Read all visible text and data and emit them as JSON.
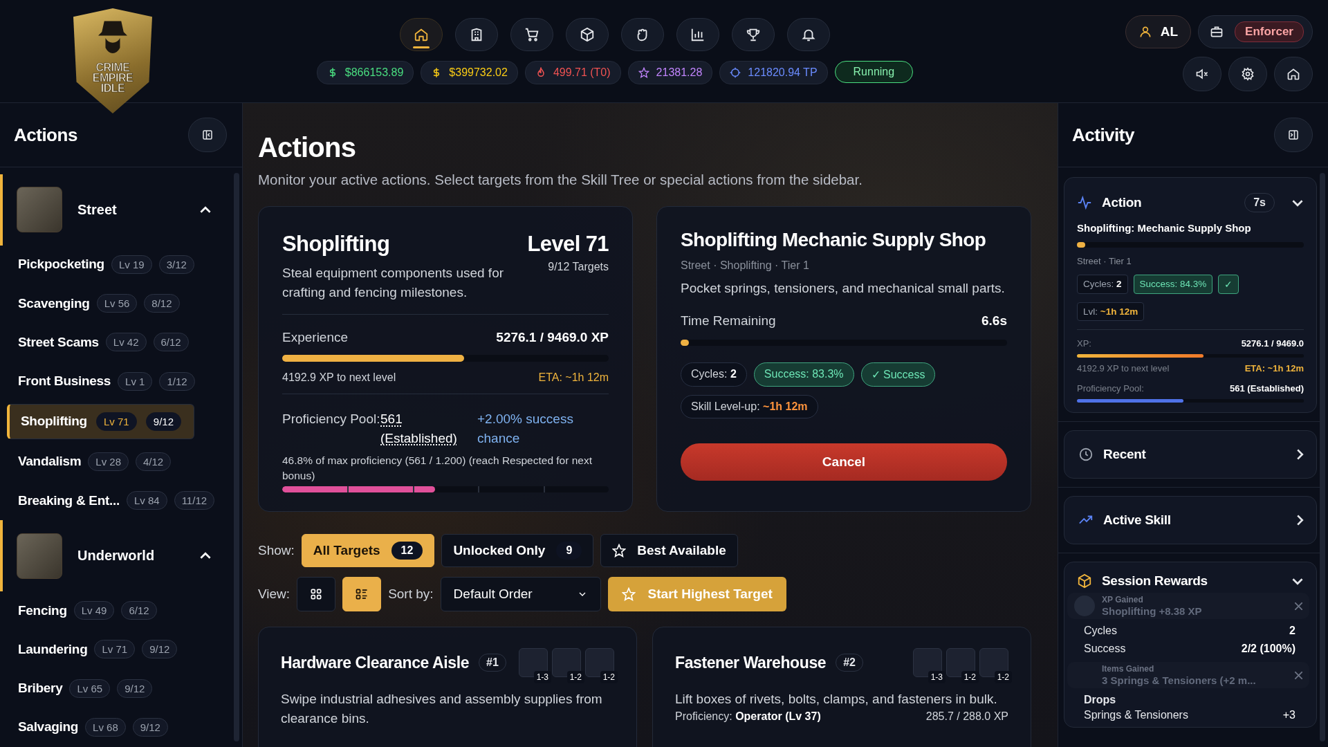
{
  "header": {
    "logo_lines": [
      "CRIME",
      "EMPIRE",
      "IDLE"
    ],
    "nav": [
      {
        "kind": "home",
        "selected": true
      },
      {
        "kind": "building",
        "selected": false
      },
      {
        "kind": "cart",
        "selected": false
      },
      {
        "kind": "box",
        "selected": false
      },
      {
        "kind": "fist",
        "selected": false
      },
      {
        "kind": "chart",
        "selected": false
      },
      {
        "kind": "trophy",
        "selected": false
      },
      {
        "kind": "bell",
        "selected": false
      }
    ],
    "resources": [
      {
        "kind": "dollar",
        "text": "$866153.89",
        "color": "#4ade80"
      },
      {
        "kind": "dollar",
        "text": "$399732.02",
        "color": "#facc15"
      },
      {
        "kind": "flame",
        "text": "499.71 (T0)",
        "color": "#f05252"
      },
      {
        "kind": "star",
        "text": "21381.28",
        "color": "#c084fc"
      },
      {
        "kind": "target",
        "text": "121820.94 TP",
        "color": "#6b8cff"
      }
    ],
    "status": "Running",
    "user": "AL",
    "rank": "Enforcer"
  },
  "sidebar": {
    "title": "Actions",
    "groups": [
      {
        "name": "Street",
        "expanded": true,
        "items": [
          {
            "name": "Pickpocketing",
            "level": "Lv 19",
            "targets": "3/12",
            "selected": false
          },
          {
            "name": "Scavenging",
            "level": "Lv 56",
            "targets": "8/12",
            "selected": false
          },
          {
            "name": "Street Scams",
            "level": "Lv 42",
            "targets": "6/12",
            "selected": false
          },
          {
            "name": "Front Business",
            "level": "Lv 1",
            "targets": "1/12",
            "selected": false
          },
          {
            "name": "Shoplifting",
            "level": "Lv 71",
            "targets": "9/12",
            "selected": true
          },
          {
            "name": "Vandalism",
            "level": "Lv 28",
            "targets": "4/12",
            "selected": false
          },
          {
            "name": "Breaking & Ent...",
            "level": "Lv 84",
            "targets": "11/12",
            "selected": false
          }
        ]
      },
      {
        "name": "Underworld",
        "expanded": true,
        "items": [
          {
            "name": "Fencing",
            "level": "Lv 49",
            "targets": "6/12",
            "selected": false
          },
          {
            "name": "Laundering",
            "level": "Lv 71",
            "targets": "9/12",
            "selected": false
          },
          {
            "name": "Bribery",
            "level": "Lv 65",
            "targets": "9/12",
            "selected": false
          },
          {
            "name": "Salvaging",
            "level": "Lv 68",
            "targets": "9/12",
            "selected": false
          }
        ]
      }
    ]
  },
  "main": {
    "title": "Actions",
    "subtitle": "Monitor your active actions. Select targets from the Skill Tree or special actions from the sidebar.",
    "skill_card": {
      "name": "Shoplifting",
      "level": "Level 71",
      "targets": "9/12 Targets",
      "description": "Steal equipment components used for crafting and fencing milestones.",
      "experience": {
        "label": "Experience",
        "value": "5276.1 / 9469.0 XP",
        "level": 0.557,
        "to_next": "4192.9 XP to next level",
        "eta": "ETA: ~1h 12m"
      },
      "proficiency": {
        "label": "Proficiency Pool:",
        "value": "561 (Established)",
        "bonus": "+2.00% success chance",
        "note": "46.8% of max proficiency (561 / 1.200) (reach Respected for next bonus)",
        "level": 0.468
      }
    },
    "action_card": {
      "title": "Shoplifting Mechanic Supply Shop",
      "meta": "Street · Shoplifting · Tier 1",
      "description": "Pocket springs, tensioners, and mechanical small parts.",
      "time_label": "Time Remaining",
      "time": "6.6s",
      "level": 0.02,
      "chips": [
        {
          "kind": "plain",
          "label": "Cycles:",
          "value": "2"
        },
        {
          "kind": "success",
          "label": "Success:",
          "value": "83.3%"
        },
        {
          "kind": "result",
          "label": "✓ Success"
        },
        {
          "kind": "eta",
          "label": "Skill Level-up:",
          "value": "~1h 12m"
        }
      ],
      "cancel": "Cancel"
    },
    "filters": {
      "show_label": "Show:",
      "options": [
        {
          "kind": "count",
          "label": "All Targets",
          "count": "12",
          "selected": true
        },
        {
          "kind": "count",
          "label": "Unlocked Only",
          "count": "9",
          "selected": false
        },
        {
          "kind": "star",
          "label": "Best Available",
          "selected": false
        }
      ],
      "view_label": "View:",
      "views": [
        {
          "kind": "grid",
          "selected": false
        },
        {
          "kind": "list",
          "selected": true
        }
      ],
      "sort_label": "Sort by:",
      "sort": "Default Order",
      "start": "Start Highest Target"
    },
    "targets": [
      {
        "name": "Hardware Clearance Aisle",
        "rank": "#1",
        "description": "Swipe industrial adhesives and assembly supplies from clearance bins.",
        "drops": [
          "1-3",
          "1-2",
          "1-2"
        ]
      },
      {
        "name": "Fastener Warehouse",
        "rank": "#2",
        "description": "Lift boxes of rivets, bolts, clamps, and fasteners in bulk.",
        "drops": [
          "1-3",
          "1-2",
          "1-2"
        ],
        "proficiency_label": "Proficiency:",
        "proficiency": "Operator (Lv 37)",
        "xp": "285.7 / 288.0 XP"
      }
    ]
  },
  "activity": {
    "title": "Activity",
    "action": {
      "title": "Action",
      "timer": "7s",
      "expanded": true,
      "name": "Shoplifting: Mechanic Supply Shop",
      "level": 0.01,
      "meta": "Street · Tier 1",
      "cycles_label": "Cycles:",
      "cycles": "2",
      "success": "Success: 84.3%",
      "check": "✓",
      "lvl_label": "Lvl:",
      "lvl": "~1h 12m",
      "xp": {
        "label": "XP:",
        "value": "5276.1 / 9469.0",
        "level": 0.557,
        "to_next": "4192.9 XP to next level",
        "eta": "ETA: ~1h 12m"
      },
      "pool": {
        "label": "Proficiency Pool:",
        "value": "561 (Established)",
        "level": 0.468
      }
    },
    "sections": [
      {
        "kind": "clock",
        "title": "Recent",
        "expanded": false
      },
      {
        "kind": "trend",
        "title": "Active Skill",
        "expanded": false
      }
    ],
    "rewards": {
      "title": "Session Rewards",
      "expanded": true,
      "rows": [
        {
          "label": "Cycles",
          "value": "2"
        },
        {
          "label": "Success",
          "value": "2/2 (100%)"
        }
      ],
      "drops_label": "Drops",
      "drops": [
        {
          "label": "Springs & Tensioners",
          "value": "+3"
        }
      ]
    },
    "toasts": [
      {
        "title": "XP Gained",
        "text": "Shoplifting +8.38 XP"
      },
      {
        "title": "Items Gained",
        "text": "3 Springs & Tensioners (+2 m..."
      }
    ]
  }
}
